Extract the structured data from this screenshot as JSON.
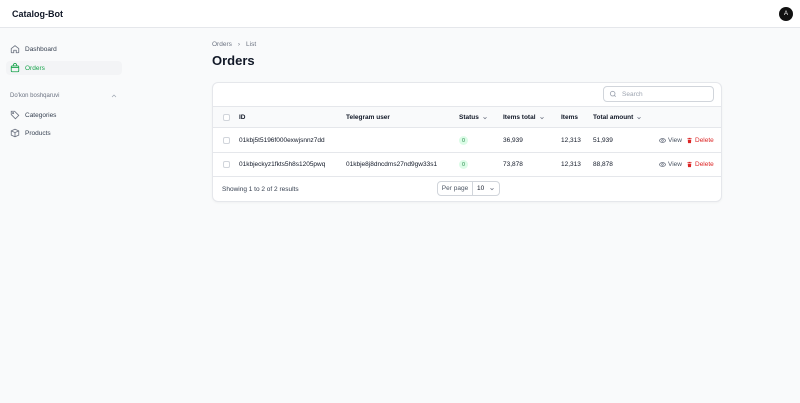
{
  "app": {
    "title": "Catalog-Bot",
    "avatar_initial": "A"
  },
  "sidebar": {
    "items": [
      {
        "label": "Dashboard",
        "icon": "home-icon"
      },
      {
        "label": "Orders",
        "icon": "shopping-bag-icon",
        "active": true
      }
    ],
    "group": {
      "label": "Do'kon boshqaruvi",
      "items": [
        {
          "label": "Categories",
          "icon": "tag-icon"
        },
        {
          "label": "Products",
          "icon": "box-icon"
        }
      ]
    }
  },
  "breadcrumb": {
    "root": "Orders",
    "current": "List"
  },
  "page": {
    "title": "Orders"
  },
  "search": {
    "placeholder": "Search",
    "value": ""
  },
  "table": {
    "columns": {
      "id": "ID",
      "telegram_user": "Telegram user",
      "status": "Status",
      "items_total": "Items total",
      "items": "Items",
      "total_amount": "Total amount"
    },
    "rows": [
      {
        "id": "01kbj5t5196f000exwjsnnz7dd",
        "telegram_user": "",
        "status": "0",
        "items_total": "36,939",
        "items": "12,313",
        "total_amount": "51,939"
      },
      {
        "id": "01kbjeckyz1fkts5h8s1205pwq",
        "telegram_user": "01kbje8j8dncdms27nd9gw33s1",
        "status": "0",
        "items_total": "73,878",
        "items": "12,313",
        "total_amount": "88,878"
      }
    ],
    "actions": {
      "view": "View",
      "delete": "Delete"
    }
  },
  "footer": {
    "summary": "Showing 1 to 2 of 2 results",
    "per_page_label": "Per page",
    "per_page_value": "10"
  },
  "colors": {
    "accent": "#16a34a",
    "danger": "#dc2626",
    "badge_bg": "#dcfce7"
  }
}
